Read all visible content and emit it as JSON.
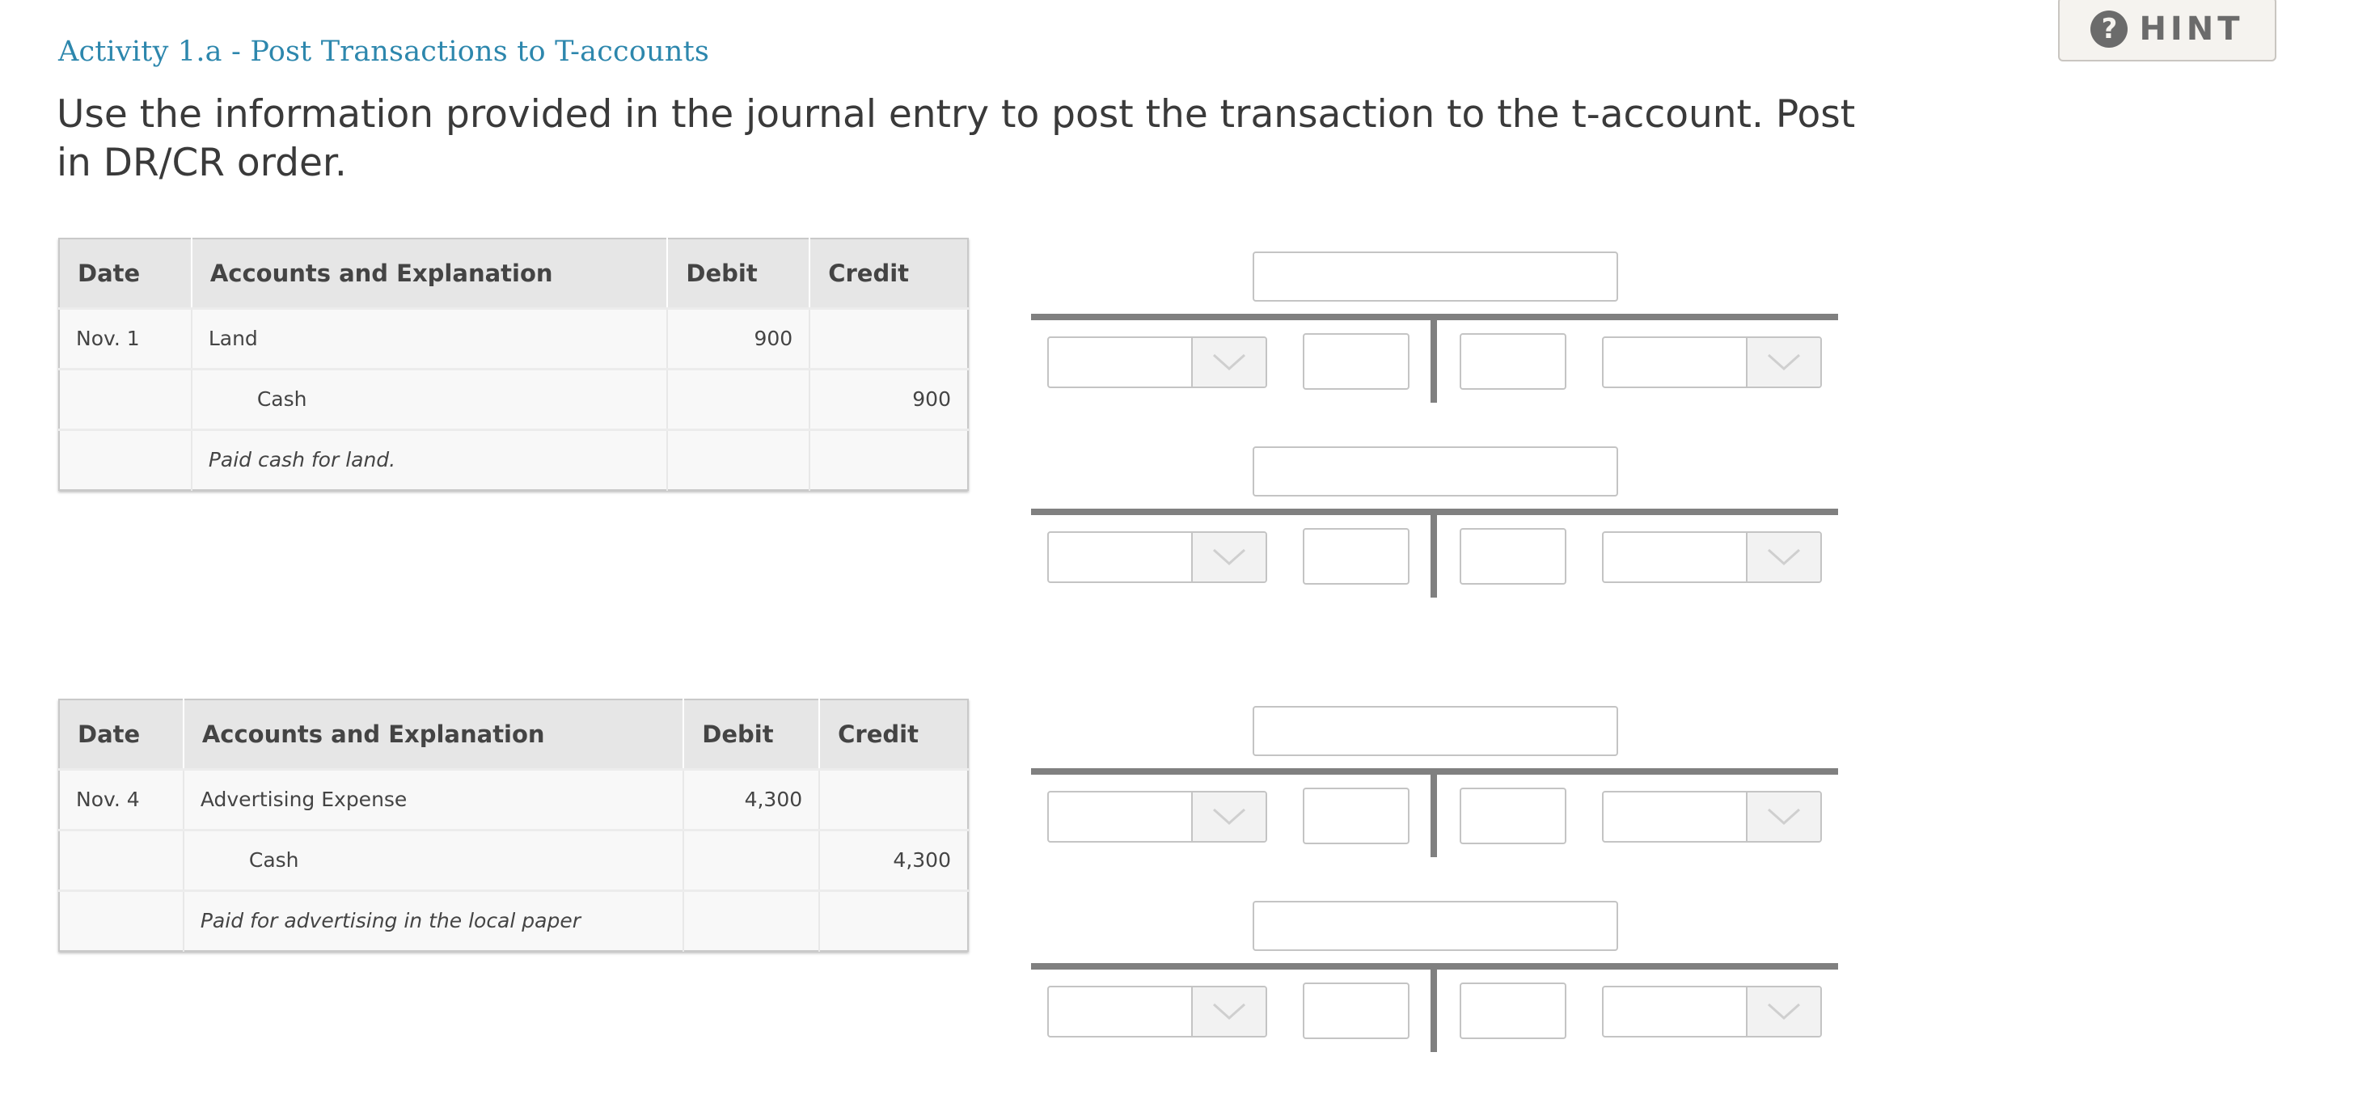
{
  "header": {
    "activity_title": "Activity 1.a - Post Transactions to T-accounts",
    "instructions": "Use the information provided in the journal entry to post the transaction to the t-account. Post in DR/CR order."
  },
  "hint_button": {
    "icon": "question-circle-icon",
    "label": "HINT"
  },
  "journal_entries": [
    {
      "columns": [
        "Date",
        "Accounts and Explanation",
        "Debit",
        "Credit"
      ],
      "rows": [
        {
          "date": "Nov. 1",
          "account": "Land",
          "debit": "900",
          "credit": ""
        },
        {
          "date": "",
          "account": "Cash",
          "debit": "",
          "credit": "900"
        },
        {
          "date": "",
          "account": "Paid cash for land.",
          "debit": "",
          "credit": ""
        }
      ]
    },
    {
      "columns": [
        "Date",
        "Accounts and Explanation",
        "Debit",
        "Credit"
      ],
      "rows": [
        {
          "date": "Nov. 4",
          "account": "Advertising Expense",
          "debit": "4,300",
          "credit": ""
        },
        {
          "date": "",
          "account": "Cash",
          "debit": "",
          "credit": "4,300"
        },
        {
          "date": "",
          "account": "Paid for advertising in the local paper",
          "debit": "",
          "credit": ""
        }
      ]
    }
  ],
  "t_accounts": [
    {
      "account_name": "",
      "debit_date": "",
      "debit_amount": "",
      "credit_amount": "",
      "credit_date": ""
    },
    {
      "account_name": "",
      "debit_date": "",
      "debit_amount": "",
      "credit_amount": "",
      "credit_date": ""
    },
    {
      "account_name": "",
      "debit_date": "",
      "debit_amount": "",
      "credit_amount": "",
      "credit_date": ""
    },
    {
      "account_name": "",
      "debit_date": "",
      "debit_amount": "",
      "credit_amount": "",
      "credit_date": ""
    }
  ],
  "colors": {
    "title_accent": "#2d87ad",
    "t_bar": "#808080",
    "header_bg": "#e6e6e6",
    "hint_bg": "#f5f3ef"
  }
}
